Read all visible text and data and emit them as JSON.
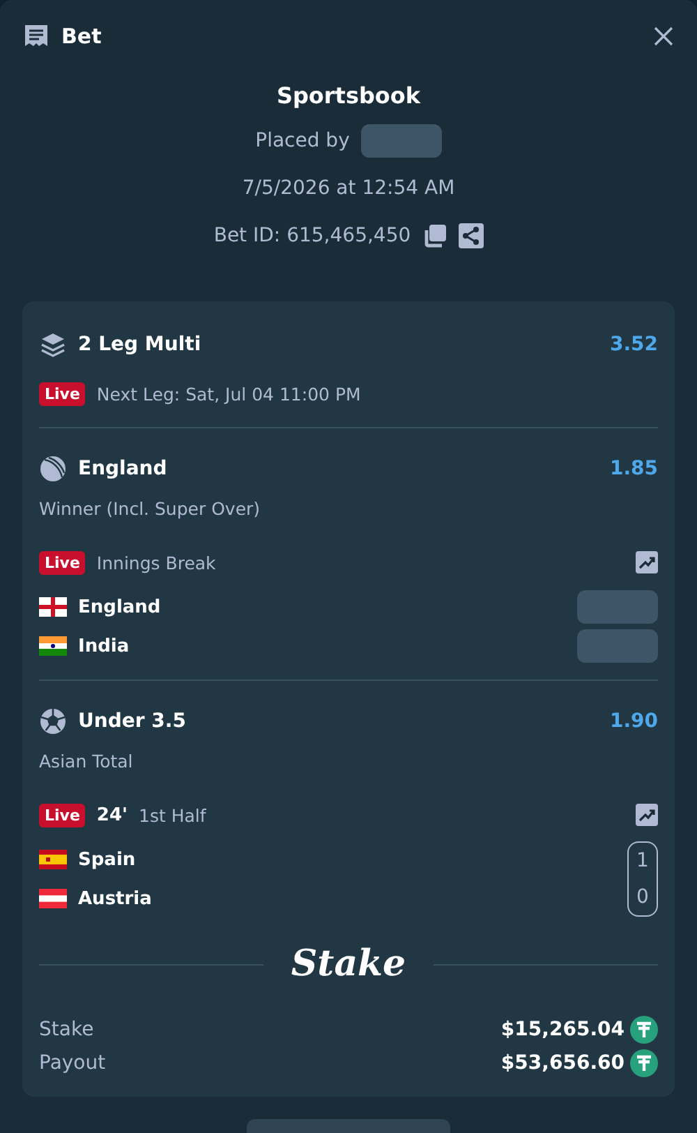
{
  "header": {
    "title": "Bet"
  },
  "summary": {
    "title": "Sportsbook",
    "placed_by": "Placed by",
    "date": "7/5/2026 at 12:54 AM",
    "bet_id": "Bet ID: 615,465,450"
  },
  "multi": {
    "title": "2 Leg Multi",
    "odds": "3.52",
    "live_badge": "Live",
    "next_leg": "Next Leg: Sat, Jul 04 11:00 PM"
  },
  "legs": [
    {
      "kind": "cricket",
      "selection": "England",
      "odds": "1.85",
      "market": "Winner (Incl. Super Over)",
      "live_badge": "Live",
      "period": "Innings Break",
      "teams": [
        {
          "kind": "england",
          "name": "England"
        },
        {
          "kind": "india",
          "name": "India"
        }
      ]
    },
    {
      "kind": "soccer",
      "selection": "Under 3.5",
      "odds": "1.90",
      "market": "Asian Total",
      "live_badge": "Live",
      "clock": "24'",
      "period": "1st Half",
      "teams": [
        {
          "kind": "spain",
          "name": "Spain",
          "score": "1"
        },
        {
          "kind": "austria",
          "name": "Austria",
          "score": "0"
        }
      ]
    }
  ],
  "brand": "Stake",
  "totals": [
    {
      "label": "Stake",
      "value": "$15,265.04"
    },
    {
      "label": "Payout",
      "value": "$53,656.60"
    }
  ]
}
